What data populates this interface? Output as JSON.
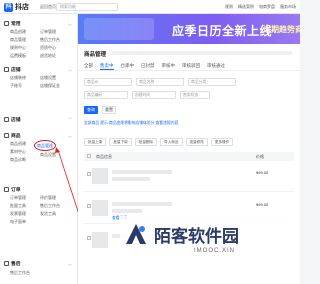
{
  "topbar": {
    "logo_text": "抖店",
    "back_label": "返回首页",
    "search_placeholder": "搜索功能",
    "nav": [
      "规则",
      "精选案例",
      "电商罗盘",
      "服务市场"
    ]
  },
  "banner": {
    "title": "应季日历全新上线",
    "subtitle": "近期趋势商"
  },
  "sidebar": {
    "sections": [
      {
        "title": "常用",
        "items": [
          "商品创建",
          "订单管理",
          "商品管理",
          "售后工作台",
          "规则中心",
          "资质中心",
          "运费模板",
          "退货地址"
        ]
      },
      {
        "title": "店铺",
        "items": [
          "店铺装修",
          "店铺设置",
          "子账号",
          "店铺保证金"
        ]
      },
      {
        "title": "店铺"
      },
      {
        "title": "商品",
        "items": [
          "商品创建",
          "商品管理",
          "素材中心",
          "商品设置",
          "商品诊断"
        ]
      },
      {
        "title": "订单",
        "items": [
          "订单管理",
          "评价管理",
          "批量工具",
          "售后工作台",
          "发票管理",
          "发货工具",
          "电子面单"
        ]
      },
      {
        "title": "售后",
        "items": [
          "售后工作台"
        ]
      }
    ]
  },
  "main": {
    "title": "商品管理",
    "tabs": [
      "全部",
      "售卖中",
      "仓库中",
      "已封禁",
      "审核中",
      "审核驳回",
      "审核通过"
    ],
    "active_tab": 1,
    "filters": {
      "row1": [
        "商品ID",
        "商品名称",
        "商品分类"
      ],
      "row2": [
        "商品编码",
        "创建时间",
        "售卖状态"
      ],
      "query_label": "查询",
      "reset_label": "重置"
    },
    "hint_text": "全部商品  提示:商品违规将影响店铺体验分 查看违规内容",
    "toolbar": [
      "批量上架",
      "批量下架",
      "批量删除",
      "导入商品",
      "批量修改",
      "更多操作"
    ],
    "columns": [
      "商品信息",
      "价格"
    ],
    "rows": [
      {
        "price": "¥99.00"
      },
      {
        "price": "¥99.00",
        "link": "查看详情"
      }
    ]
  },
  "watermark": {
    "text": "陌客软件园",
    "sub": "IMOOC.XIN"
  }
}
